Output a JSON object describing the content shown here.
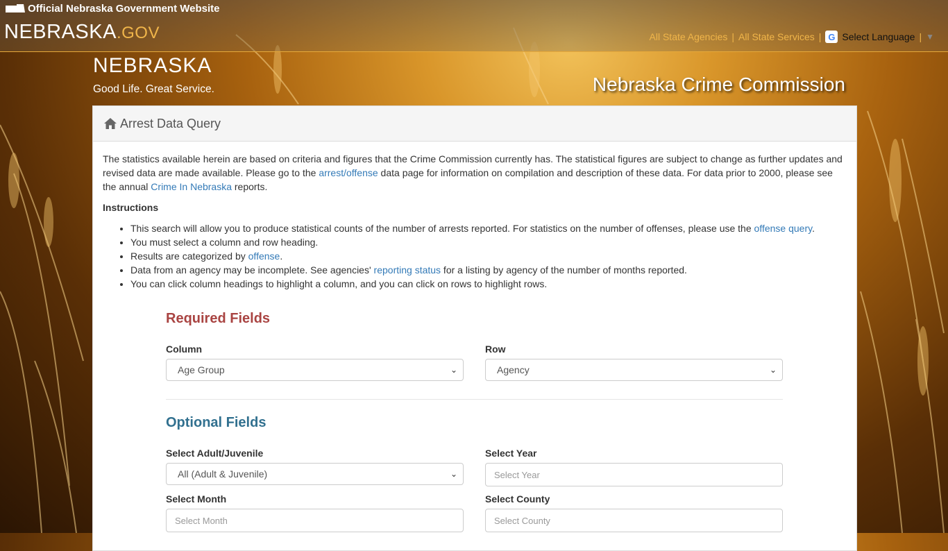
{
  "header": {
    "official_text": "Official Nebraska Government Website",
    "portal_logo_main": "NEBRASKA",
    "portal_logo_gov": ".GOV",
    "links": [
      "All State Agencies",
      "All State Services"
    ],
    "separator": "|",
    "language_label": "Select Language",
    "language_caret": "▼"
  },
  "brand": {
    "logo": "NEBRASKA",
    "tagline": "Good Life. Great Service.",
    "site_title": "Nebraska Crime Commission"
  },
  "panel": {
    "title": "Arrest Data Query",
    "intro": {
      "t1": "The statistics available herein are based on criteria and figures that the Crime Commission currently has. The statistical figures are subject to change as further updates and revised data are made available. Please go to the ",
      "link1": "arrest/offense",
      "t2": " data page for information on compilation and description of these data. For data prior to 2000, please see the annual ",
      "link2": "Crime In Nebraska",
      "t3": " reports."
    },
    "instructions_title": "Instructions",
    "instructions": {
      "i1_text": "This search will allow you to produce statistical counts of the number of arrests reported. For statistics on the number of offenses, please use the ",
      "i1_link": "offense query",
      "i1_end": ".",
      "i2": "You must select a column and row heading.",
      "i3_text": "Results are categorized by ",
      "i3_link": "offense",
      "i3_end": ".",
      "i4_text": "Data from an agency may be incomplete. See agencies' ",
      "i4_link": "reporting status",
      "i4_end": " for a listing by agency of the number of months reported.",
      "i5": "You can click column headings to highlight a column, and you can click on rows to highlight rows."
    }
  },
  "form": {
    "required_title": "Required Fields",
    "column_label": "Column",
    "column_value": "Age Group",
    "row_label": "Row",
    "row_value": "Agency",
    "optional_title": "Optional Fields",
    "adult_label": "Select Adult/Juvenile",
    "adult_value": "All (Adult & Juvenile)",
    "year_label": "Select Year",
    "year_placeholder": "Select Year",
    "month_label": "Select Month",
    "month_placeholder": "Select Month",
    "county_label": "Select County",
    "county_placeholder": "Select County"
  },
  "icons": {
    "home": "home-icon",
    "dropdown": "chevron-down-icon",
    "google": "google-icon",
    "state": "nebraska-state-icon"
  }
}
